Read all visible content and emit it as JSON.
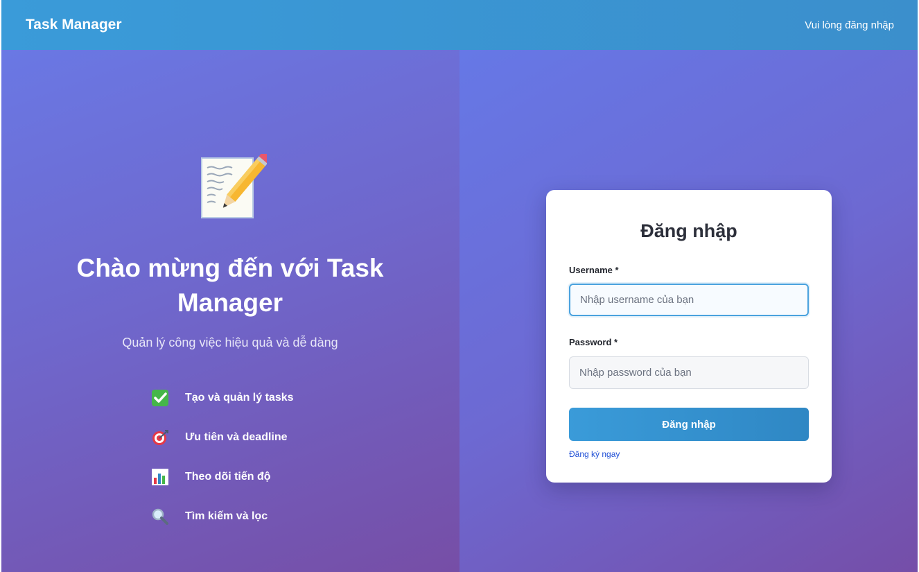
{
  "header": {
    "brand": "Task Manager",
    "status": "Vui lòng đăng nhập"
  },
  "welcome": {
    "icon": "memo-pencil-icon",
    "title": "Chào mừng đến với Task Manager",
    "subtitle": "Quản lý công việc hiệu quả và dễ dàng",
    "features": [
      {
        "icon": "check-icon",
        "label": "Tạo và quản lý tasks"
      },
      {
        "icon": "target-icon",
        "label": "Ưu tiên và deadline"
      },
      {
        "icon": "bar-chart-icon",
        "label": "Theo dõi tiến độ"
      },
      {
        "icon": "search-icon",
        "label": "Tìm kiếm và lọc"
      }
    ]
  },
  "login": {
    "title": "Đăng nhập",
    "username_label": "Username *",
    "username_placeholder": "Nhập username của bạn",
    "username_value": "",
    "password_label": "Password *",
    "password_placeholder": "Nhập password của bạn",
    "password_value": "",
    "submit_label": "Đăng nhập",
    "register_link": "Đăng ký ngay"
  },
  "colors": {
    "header": "#3a9bd9",
    "accent": "#2f87c4",
    "gradient_start": "#6a78e4",
    "gradient_end": "#764ea6",
    "link": "#1f4fd6"
  }
}
